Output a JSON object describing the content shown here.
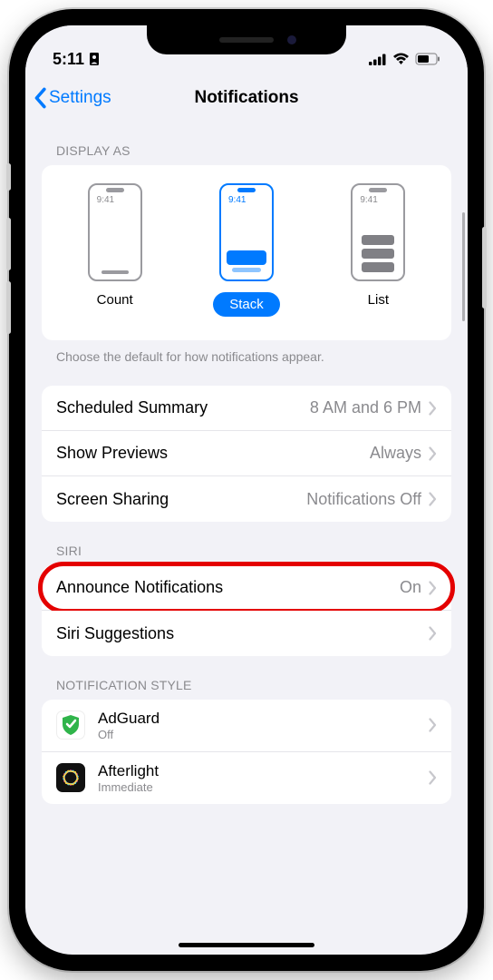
{
  "status": {
    "time": "5:11",
    "carrier_icon": "▮"
  },
  "nav": {
    "back_label": "Settings",
    "title": "Notifications"
  },
  "display_as": {
    "header": "DISPLAY AS",
    "options": [
      {
        "label": "Count",
        "preview_time": "9:41"
      },
      {
        "label": "Stack",
        "preview_time": "9:41"
      },
      {
        "label": "List",
        "preview_time": "9:41"
      }
    ],
    "footer": "Choose the default for how notifications appear."
  },
  "general": {
    "rows": [
      {
        "title": "Scheduled Summary",
        "value": "8 AM and 6 PM"
      },
      {
        "title": "Show Previews",
        "value": "Always"
      },
      {
        "title": "Screen Sharing",
        "value": "Notifications Off"
      }
    ]
  },
  "siri": {
    "header": "SIRI",
    "rows": [
      {
        "title": "Announce Notifications",
        "value": "On"
      },
      {
        "title": "Siri Suggestions",
        "value": ""
      }
    ]
  },
  "notification_style": {
    "header": "NOTIFICATION STYLE",
    "apps": [
      {
        "name": "AdGuard",
        "sub": "Off"
      },
      {
        "name": "Afterlight",
        "sub": "Immediate"
      }
    ]
  }
}
